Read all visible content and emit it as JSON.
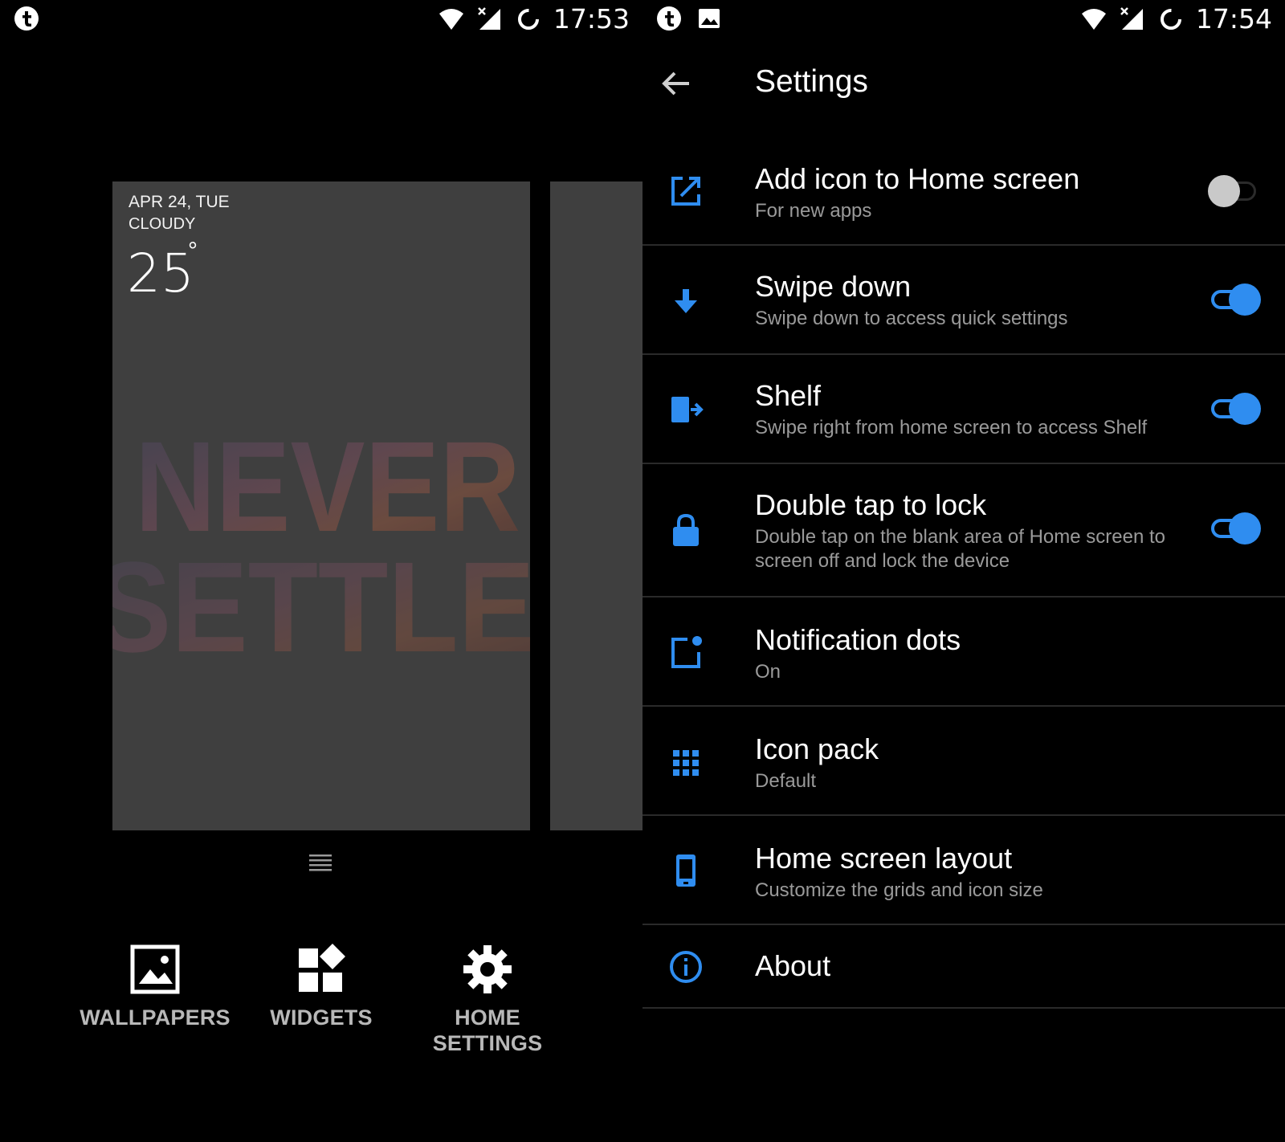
{
  "colors": {
    "background": "#000000",
    "accent": "#2f8df0",
    "card": "#3f3f3f",
    "secondary_text": "#9a9a9a",
    "action_label": "#b8b8b8"
  },
  "left": {
    "status_bar": {
      "time": "17:53",
      "icons": [
        "app-t-icon",
        "wifi-icon",
        "signal-icon",
        "sync-icon"
      ]
    },
    "preview": {
      "date": "APR 24, TUE",
      "weather": "CLOUDY",
      "temperature": "25",
      "degree": "°",
      "wallpaper_lines": [
        "NEVER",
        "SETTLE"
      ]
    },
    "actions": [
      {
        "label": "WALLPAPERS",
        "icon": "wallpaper-icon"
      },
      {
        "label": "WIDGETS",
        "icon": "widgets-icon"
      },
      {
        "label": "HOME\nSETTINGS",
        "label_line1": "HOME",
        "label_line2": "SETTINGS",
        "icon": "gear-icon"
      }
    ]
  },
  "right": {
    "status_bar": {
      "time": "17:54",
      "icons": [
        "app-t-icon",
        "image-icon",
        "wifi-icon",
        "signal-icon",
        "sync-icon"
      ]
    },
    "title": "Settings",
    "items": [
      {
        "title": "Add icon to Home screen",
        "subtitle": "For new apps",
        "icon": "add-to-home-icon",
        "toggle": "off"
      },
      {
        "title": "Swipe down",
        "subtitle": "Swipe down to access quick settings",
        "icon": "arrow-down-icon",
        "toggle": "on"
      },
      {
        "title": "Shelf",
        "subtitle": "Swipe right from home screen to access Shelf",
        "icon": "shelf-icon",
        "toggle": "on"
      },
      {
        "title": "Double tap to lock",
        "subtitle": "Double tap on the blank area of Home screen to screen off and lock the device",
        "icon": "lock-icon",
        "toggle": "on"
      },
      {
        "title": "Notification dots",
        "subtitle": "On",
        "icon": "notification-dot-icon"
      },
      {
        "title": "Icon pack",
        "subtitle": "Default",
        "icon": "grid-icon"
      },
      {
        "title": "Home screen layout",
        "subtitle": "Customize the grids and icon size",
        "icon": "phone-icon"
      },
      {
        "title": "About",
        "icon": "info-icon"
      }
    ]
  }
}
